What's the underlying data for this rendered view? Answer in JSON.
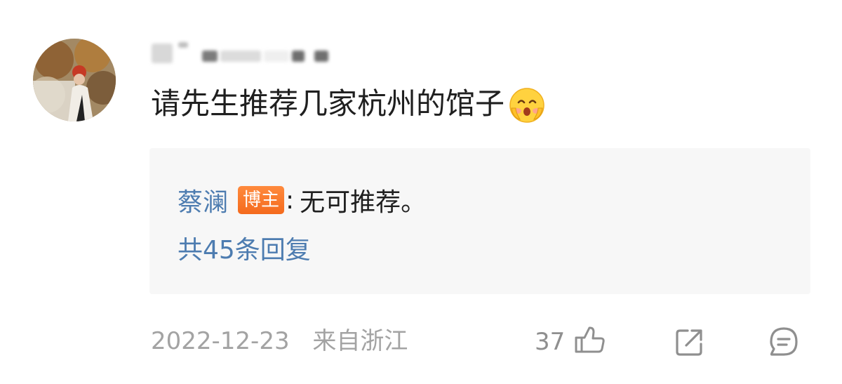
{
  "comment": {
    "text": "请先生推荐几家杭州的馆子",
    "emoji": "smiling-blushing-face-emoji"
  },
  "reply": {
    "author": "蔡澜",
    "badge": "博主",
    "colon": ":",
    "text": "无可推荐。",
    "count_label": "共45条回复"
  },
  "footer": {
    "date": "2022-12-23",
    "location": "来自浙江",
    "like_count": "37"
  },
  "icons": {
    "like": "thumbs-up-icon",
    "share": "share-icon",
    "comment": "comment-icon"
  },
  "colors": {
    "link_blue": "#4d7cb0",
    "badge_orange": "#f46a1d",
    "reply_bg": "#f7f7f7",
    "meta_gray": "#a3a3a3"
  }
}
